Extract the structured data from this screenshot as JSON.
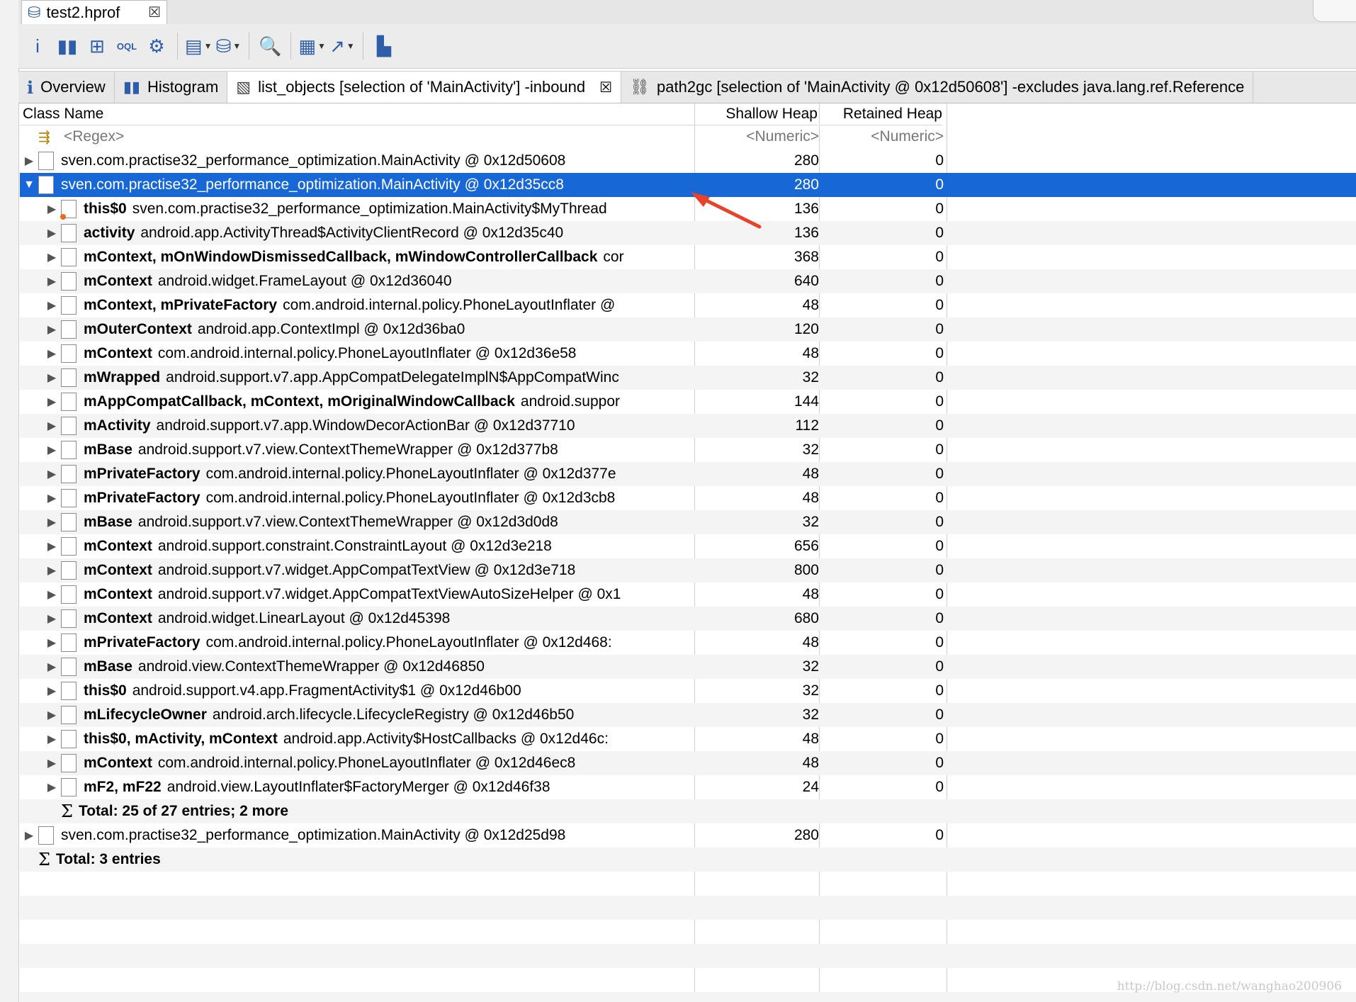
{
  "editor_tab": {
    "title": "test2.hprof"
  },
  "toolbar": {
    "buttons": [
      {
        "name": "info-button",
        "glyph": "i"
      },
      {
        "name": "histogram-button",
        "glyph": "▮▮"
      },
      {
        "name": "dominator-tree-button",
        "glyph": "⊞"
      },
      {
        "name": "oql-button",
        "glyph": "OQL"
      },
      {
        "name": "threads-button",
        "glyph": "⚙"
      },
      {
        "name": "reports-button",
        "glyph": "▤"
      },
      {
        "name": "query-browser-button",
        "glyph": "⛁"
      },
      {
        "name": "find-object-button",
        "glyph": "🔍"
      },
      {
        "name": "calculate-heap-button",
        "glyph": "▦"
      },
      {
        "name": "export-button",
        "glyph": "↗"
      },
      {
        "name": "heap-dump-overview-button",
        "glyph": "▙"
      }
    ]
  },
  "view_tabs": [
    {
      "label": "Overview",
      "icon": "info-icon"
    },
    {
      "label": "Histogram",
      "icon": "histogram-icon"
    },
    {
      "label": "list_objects [selection of 'MainActivity'] -inbound",
      "icon": "document-icon",
      "active": true,
      "closable": true
    },
    {
      "label": "path2gc [selection of 'MainActivity @ 0x12d50608'] -excludes java.lang.ref.Reference",
      "icon": "path-icon"
    }
  ],
  "table": {
    "columns": {
      "class_name": "Class Name",
      "shallow_heap": "Shallow Heap",
      "retained_heap": "Retained Heap"
    },
    "filter": {
      "name": "<Regex>",
      "shallow": "<Numeric>",
      "retained": "<Numeric>"
    },
    "rows": [
      {
        "level": 0,
        "expand": "collapsed",
        "field": "",
        "cls": "sven.com.practise32_performance_optimization.MainActivity @ 0x12d50608",
        "shallow": "280",
        "retained": "0"
      },
      {
        "level": 0,
        "expand": "expanded",
        "field": "",
        "cls": "sven.com.practise32_performance_optimization.MainActivity @ 0x12d35cc8",
        "shallow": "280",
        "retained": "0",
        "selected": true
      },
      {
        "level": 1,
        "expand": "collapsed",
        "field": "this$0",
        "cls": "sven.com.practise32_performance_optimization.MainActivity$MyThread",
        "shallow": "136",
        "retained": "0",
        "ref": true
      },
      {
        "level": 1,
        "expand": "collapsed",
        "field": "activity",
        "cls": "android.app.ActivityThread$ActivityClientRecord @ 0x12d35c40",
        "shallow": "136",
        "retained": "0"
      },
      {
        "level": 1,
        "expand": "collapsed",
        "field": "mContext, mOnWindowDismissedCallback, mWindowControllerCallback",
        "cls": "cor",
        "shallow": "368",
        "retained": "0"
      },
      {
        "level": 1,
        "expand": "collapsed",
        "field": "mContext",
        "cls": "android.widget.FrameLayout @ 0x12d36040",
        "shallow": "640",
        "retained": "0"
      },
      {
        "level": 1,
        "expand": "collapsed",
        "field": "mContext, mPrivateFactory",
        "cls": "com.android.internal.policy.PhoneLayoutInflater @",
        "shallow": "48",
        "retained": "0"
      },
      {
        "level": 1,
        "expand": "collapsed",
        "field": "mOuterContext",
        "cls": "android.app.ContextImpl @ 0x12d36ba0",
        "shallow": "120",
        "retained": "0"
      },
      {
        "level": 1,
        "expand": "collapsed",
        "field": "mContext",
        "cls": "com.android.internal.policy.PhoneLayoutInflater @ 0x12d36e58",
        "shallow": "48",
        "retained": "0"
      },
      {
        "level": 1,
        "expand": "collapsed",
        "field": "mWrapped",
        "cls": "android.support.v7.app.AppCompatDelegateImplN$AppCompatWinc",
        "shallow": "32",
        "retained": "0"
      },
      {
        "level": 1,
        "expand": "collapsed",
        "field": "mAppCompatCallback, mContext, mOriginalWindowCallback",
        "cls": "android.suppor",
        "shallow": "144",
        "retained": "0"
      },
      {
        "level": 1,
        "expand": "collapsed",
        "field": "mActivity",
        "cls": "android.support.v7.app.WindowDecorActionBar @ 0x12d37710",
        "shallow": "112",
        "retained": "0"
      },
      {
        "level": 1,
        "expand": "collapsed",
        "field": "mBase",
        "cls": "android.support.v7.view.ContextThemeWrapper @ 0x12d377b8",
        "shallow": "32",
        "retained": "0"
      },
      {
        "level": 1,
        "expand": "collapsed",
        "field": "mPrivateFactory",
        "cls": "com.android.internal.policy.PhoneLayoutInflater @ 0x12d377e",
        "shallow": "48",
        "retained": "0"
      },
      {
        "level": 1,
        "expand": "collapsed",
        "field": "mPrivateFactory",
        "cls": "com.android.internal.policy.PhoneLayoutInflater @ 0x12d3cb8",
        "shallow": "48",
        "retained": "0"
      },
      {
        "level": 1,
        "expand": "collapsed",
        "field": "mBase",
        "cls": "android.support.v7.view.ContextThemeWrapper @ 0x12d3d0d8",
        "shallow": "32",
        "retained": "0"
      },
      {
        "level": 1,
        "expand": "collapsed",
        "field": "mContext",
        "cls": "android.support.constraint.ConstraintLayout @ 0x12d3e218",
        "shallow": "656",
        "retained": "0"
      },
      {
        "level": 1,
        "expand": "collapsed",
        "field": "mContext",
        "cls": "android.support.v7.widget.AppCompatTextView @ 0x12d3e718",
        "shallow": "800",
        "retained": "0"
      },
      {
        "level": 1,
        "expand": "collapsed",
        "field": "mContext",
        "cls": "android.support.v7.widget.AppCompatTextViewAutoSizeHelper @ 0x1",
        "shallow": "48",
        "retained": "0"
      },
      {
        "level": 1,
        "expand": "collapsed",
        "field": "mContext",
        "cls": "android.widget.LinearLayout @ 0x12d45398",
        "shallow": "680",
        "retained": "0"
      },
      {
        "level": 1,
        "expand": "collapsed",
        "field": "mPrivateFactory",
        "cls": "com.android.internal.policy.PhoneLayoutInflater @ 0x12d468:",
        "shallow": "48",
        "retained": "0"
      },
      {
        "level": 1,
        "expand": "collapsed",
        "field": "mBase",
        "cls": "android.view.ContextThemeWrapper @ 0x12d46850",
        "shallow": "32",
        "retained": "0"
      },
      {
        "level": 1,
        "expand": "collapsed",
        "field": "this$0",
        "cls": "android.support.v4.app.FragmentActivity$1 @ 0x12d46b00",
        "shallow": "32",
        "retained": "0"
      },
      {
        "level": 1,
        "expand": "collapsed",
        "field": "mLifecycleOwner",
        "cls": "android.arch.lifecycle.LifecycleRegistry @ 0x12d46b50",
        "shallow": "32",
        "retained": "0"
      },
      {
        "level": 1,
        "expand": "collapsed",
        "field": "this$0, mActivity, mContext",
        "cls": "android.app.Activity$HostCallbacks @ 0x12d46c:",
        "shallow": "48",
        "retained": "0"
      },
      {
        "level": 1,
        "expand": "collapsed",
        "field": "mContext",
        "cls": "com.android.internal.policy.PhoneLayoutInflater @ 0x12d46ec8",
        "shallow": "48",
        "retained": "0"
      },
      {
        "level": 1,
        "expand": "collapsed",
        "field": "mF2, mF22",
        "cls": "android.view.LayoutInflater$FactoryMerger @ 0x12d46f38",
        "shallow": "24",
        "retained": "0"
      },
      {
        "level": 1,
        "expand": "total",
        "field": "Total: 25 of 27 entries; 2 more",
        "cls": "",
        "shallow": "",
        "retained": ""
      },
      {
        "level": 0,
        "expand": "collapsed",
        "field": "",
        "cls": "sven.com.practise32_performance_optimization.MainActivity @ 0x12d25d98",
        "shallow": "280",
        "retained": "0"
      },
      {
        "level": 0,
        "expand": "total",
        "field": "Total: 3 entries",
        "cls": "",
        "shallow": "",
        "retained": ""
      }
    ]
  },
  "watermark": "http://blog.csdn.net/wanghao200906",
  "colors": {
    "selection": "#1867d7",
    "accent_icon": "#2e5ea8",
    "arrow": "#e8432a"
  }
}
